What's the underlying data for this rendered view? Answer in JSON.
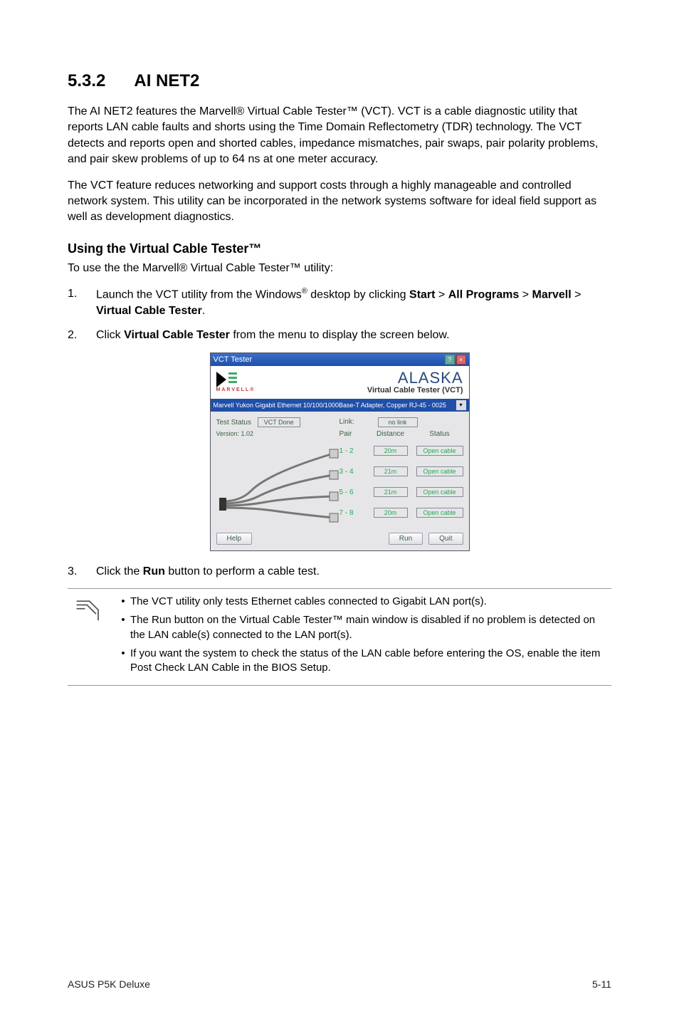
{
  "section": {
    "number": "5.3.2",
    "title": "AI NET2"
  },
  "intro_para": "The AI NET2 features the Marvell® Virtual Cable Tester™ (VCT). VCT is a cable diagnostic utility that reports LAN cable faults and shorts using the Time Domain Reflectometry (TDR) technology. The VCT detects and reports open and shorted cables, impedance mismatches, pair swaps, pair polarity problems, and pair skew problems of up to 64 ns at one meter accuracy.",
  "para2": "The VCT feature reduces networking and support costs through a highly manageable and controlled network system. This utility can be incorporated in the network systems software for ideal field support as well as development diagnostics.",
  "subheading": "Using the Virtual Cable Tester™",
  "subpara": "To use the the Marvell® Virtual Cable Tester™  utility:",
  "steps": {
    "s1": {
      "num": "1.",
      "pre": "Launch the VCT utility from the Windows",
      "post": " desktop by clicking ",
      "b1": "Start",
      "gt1": " > ",
      "b2": "All Programs",
      "gt2": " > ",
      "b3": "Marvell",
      "gt3": " > ",
      "b4": "Virtual Cable Tester",
      "end": "."
    },
    "s2": {
      "num": "2.",
      "pre": "Click ",
      "b1": "Virtual Cable Tester",
      "post": " from the menu to display the screen below."
    },
    "s3": {
      "num": "3.",
      "pre": "Click the ",
      "b1": "Run",
      "post": " button to perform a cable test."
    }
  },
  "vct": {
    "titlebar": "VCT Tester",
    "marvell_text": "MARVELL®",
    "alaska": "ALASKA",
    "alaska_sub": "Virtual Cable Tester (VCT)",
    "dropdown": "Marvell Yukon Gigabit Ethernet 10/100/1000Base-T Adapter, Copper RJ-45 - 0025",
    "test_status_label": "Test Status",
    "test_status_value": "VCT Done",
    "version": "Version: 1.02",
    "link_label": "Link:",
    "link_value": "no link",
    "head_pair": "Pair",
    "head_distance": "Distance",
    "head_status": "Status",
    "rows": [
      {
        "pair": "1 - 2",
        "dist": "20m",
        "stat": "Open cable"
      },
      {
        "pair": "3 - 4",
        "dist": "21m",
        "stat": "Open cable"
      },
      {
        "pair": "5 - 6",
        "dist": "21m",
        "stat": "Open cable"
      },
      {
        "pair": "7 - 8",
        "dist": "20m",
        "stat": "Open cable"
      }
    ],
    "btn_help": "Help",
    "btn_run": "Run",
    "btn_quit": "Quit"
  },
  "notes": {
    "n1": "The VCT utility only tests Ethernet cables connected to Gigabit LAN port(s).",
    "n2": "The Run button on the Virtual Cable Tester™ main window is disabled if no problem is detected on the LAN cable(s) connected to the LAN port(s).",
    "n3": "If you want the system to check the status of the LAN cable before entering the OS, enable the item Post Check LAN Cable in the BIOS Setup."
  },
  "footer": {
    "left": "ASUS P5K Deluxe",
    "right": "5-11"
  }
}
